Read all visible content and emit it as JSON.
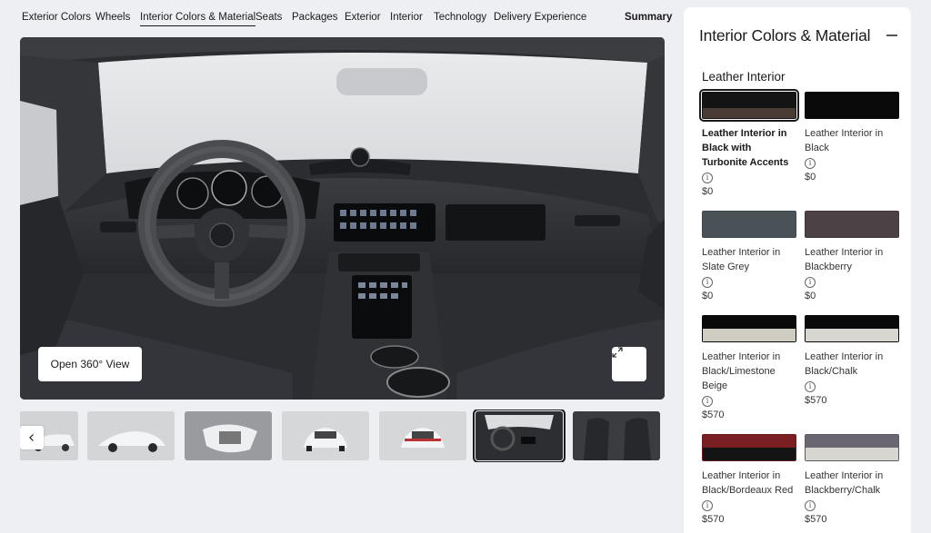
{
  "nav": {
    "items": [
      "Exterior Colors",
      "Wheels",
      "Interior Colors & Material",
      "Seats",
      "Packages",
      "Exterior",
      "Interior",
      "Technology",
      "Delivery Experience"
    ],
    "summary": "Summary",
    "active_index": 2
  },
  "viewer": {
    "open_360_label": "Open 360° View",
    "expand_icon": "expand-icon"
  },
  "thumbnails": {
    "count": 7,
    "selected_index": 5,
    "prev_icon": "chevron-left-icon"
  },
  "panel": {
    "title": "Interior Colors & Material",
    "section": "Leather Interior",
    "options": [
      {
        "name": "Leather Interior in Black with Turbonite Accents",
        "price": "$0",
        "color": "#141414",
        "band": "#4a3c34",
        "selected": true
      },
      {
        "name": "Leather Interior in Black",
        "price": "$0",
        "color": "#0a0a0a",
        "band": "",
        "selected": false
      },
      {
        "name": "Leather Interior in Slate Grey",
        "price": "$0",
        "color": "#4b5257",
        "band": "",
        "selected": false
      },
      {
        "name": "Leather Interior in Blackberry",
        "price": "$0",
        "color": "#4c4246",
        "band": "",
        "selected": false
      },
      {
        "name": "Leather Interior in Black/Limestone Beige",
        "price": "$570",
        "color": "#0a0a0a",
        "band": "#cfccc1",
        "selected": false
      },
      {
        "name": "Leather Interior in Black/Chalk",
        "price": "$570",
        "color": "#0a0a0a",
        "band": "#d7d6d1",
        "selected": false
      },
      {
        "name": "Leather Interior in Black/Bordeaux Red",
        "price": "$570",
        "color": "#7a1f22",
        "band": "#141414",
        "selected": false
      },
      {
        "name": "Leather Interior in Blackberry/Chalk",
        "price": "$570",
        "color": "#6b6772",
        "band": "#d7d6d1",
        "selected": false
      }
    ]
  }
}
